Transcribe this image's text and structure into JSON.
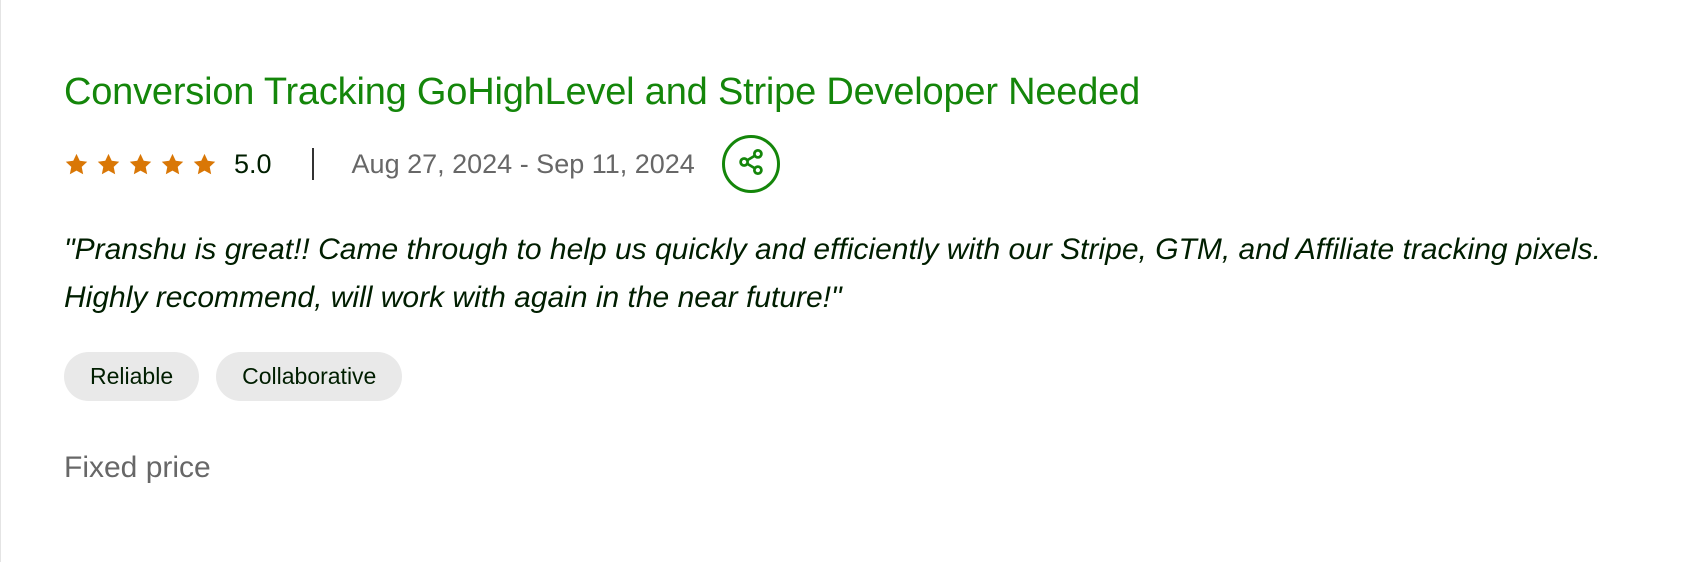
{
  "review": {
    "title": "Conversion Tracking GoHighLevel and Stripe Developer Needed",
    "rating": {
      "stars": 5,
      "max_stars": 5,
      "value_label": "5.0",
      "star_color": "#d97706"
    },
    "date_range": "Aug 27, 2024 - Sep 11, 2024",
    "share_icon": "share-icon",
    "feedback": "\"Pranshu is great!! Came through to help us quickly and efficiently with our Stripe, GTM, and Affiliate tracking pixels. Highly recommend, will work with again in the near future!\"",
    "tags": [
      "Reliable",
      "Collaborative"
    ],
    "contract_type": "Fixed price"
  },
  "colors": {
    "accent_green": "#14860a",
    "muted_text": "#676767",
    "tag_bg": "#e9e9e9"
  }
}
